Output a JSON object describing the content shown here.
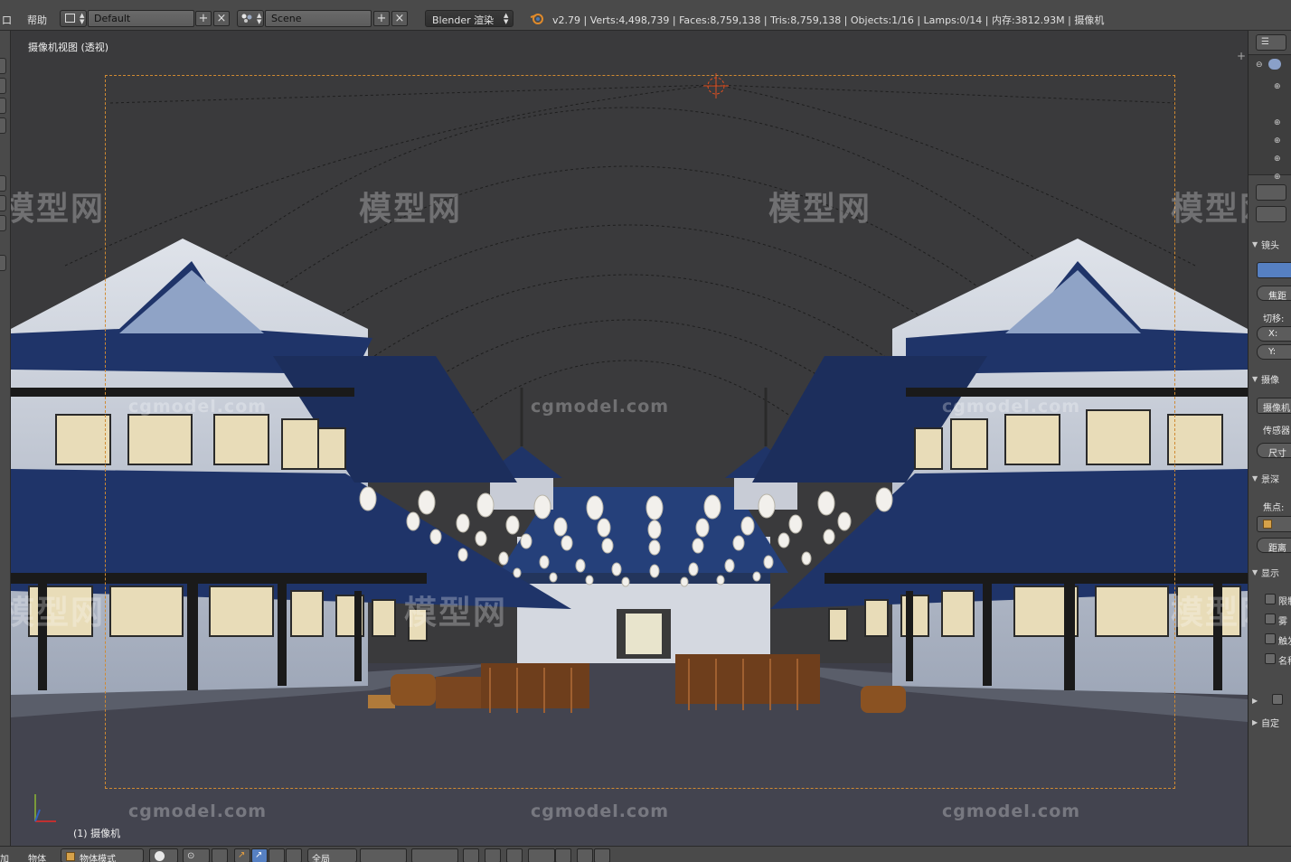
{
  "topbar": {
    "menu_window": "口",
    "menu_help": "帮助",
    "screen_layout": "Default",
    "scene": "Scene",
    "render_engine": "Blender 渲染",
    "stats": "v2.79 | Verts:4,498,739 | Faces:8,759,138 | Tris:8,759,138 | Objects:1/16 | Lamps:0/14 | 内存:3812.93M | 摄像机"
  },
  "viewport": {
    "view_label": "摄像机视图 (透视)",
    "object_label": "(1) 摄像机",
    "watermark_logo": "模型网",
    "watermark_url": "cgmodel.com"
  },
  "right_panel": {
    "lens_header": "镜头",
    "focal_label": "焦距",
    "shift_label": "切移:",
    "shift_x": "X:",
    "shift_y": "Y:",
    "camera_header": "摄像",
    "camera_preset": "摄像机",
    "sensor_label": "传感器",
    "size_label": "尺寸",
    "dof_header": "景深",
    "focus_label": "焦点:",
    "distance_label": "距离",
    "display_header": "显示",
    "limits_label": "限制",
    "mist_label": "雾",
    "sensor_chk_label": "触发",
    "name_label": "名称",
    "custom_header": "自定"
  },
  "bottombar": {
    "add_menu": "加",
    "object_menu": "物体",
    "mode": "物体模式",
    "pivot": "全局"
  },
  "colors": {
    "frame_border": "#d08a32",
    "header_bg": "#4a4a4a",
    "viewport_bg": "#393939",
    "active_blue": "#5680c2"
  }
}
